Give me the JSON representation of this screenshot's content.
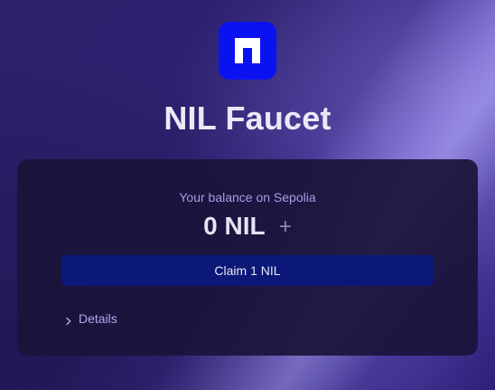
{
  "app": {
    "title": "NIL Faucet",
    "logo_icon": "nil-logo-icon",
    "brand_color": "#0a12f2"
  },
  "balance": {
    "label": "Your balance on Sepolia",
    "amount": "0",
    "unit": "NIL",
    "add_icon": "plus-icon",
    "add_symbol": "+"
  },
  "actions": {
    "claim_label": "Claim 1 NIL",
    "claim_color": "#0b1878"
  },
  "details": {
    "label": "Details",
    "icon": "chevron-right-icon"
  }
}
